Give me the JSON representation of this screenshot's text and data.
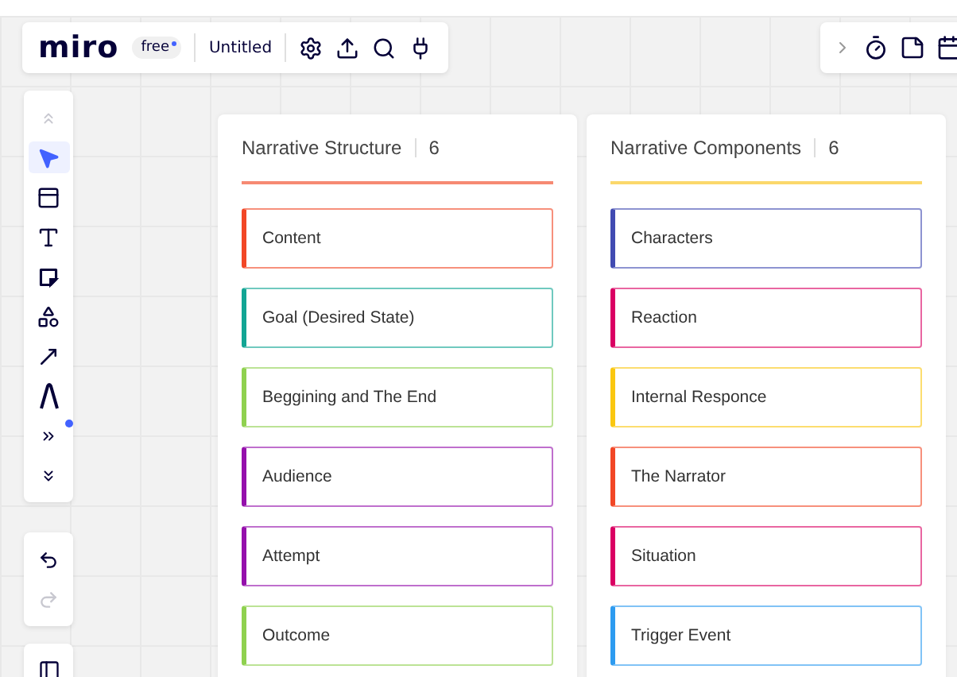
{
  "topbar": {
    "logo": "miro",
    "plan": "free",
    "plan_dot": true,
    "board_title": "Untitled",
    "actions": [
      {
        "kind": "settings"
      },
      {
        "kind": "upload"
      },
      {
        "kind": "search"
      },
      {
        "kind": "plug"
      }
    ]
  },
  "right_toolbar": {
    "items": [
      {
        "kind": "expand"
      },
      {
        "kind": "timer"
      },
      {
        "kind": "sticky"
      },
      {
        "kind": "partial"
      }
    ]
  },
  "tools": [
    {
      "kind": "collapse",
      "selected": false,
      "disabled": true
    },
    {
      "kind": "select",
      "selected": true,
      "disabled": false
    },
    {
      "kind": "frame",
      "selected": false,
      "disabled": false
    },
    {
      "kind": "text",
      "selected": false,
      "disabled": false
    },
    {
      "kind": "sticky",
      "selected": false,
      "disabled": false
    },
    {
      "kind": "shapes",
      "selected": false,
      "disabled": false
    },
    {
      "kind": "arrow",
      "selected": false,
      "disabled": false
    },
    {
      "kind": "pen",
      "selected": false,
      "disabled": false
    },
    {
      "kind": "more",
      "selected": false,
      "disabled": false
    },
    {
      "kind": "expand",
      "selected": false,
      "disabled": false
    }
  ],
  "more_tools_badge": true,
  "history": [
    {
      "kind": "undo",
      "disabled": false
    },
    {
      "kind": "redo",
      "disabled": true
    }
  ],
  "columns": [
    {
      "title": "Narrative Structure",
      "count": "6",
      "color": "#f68a73",
      "cards": [
        {
          "text": "Content",
          "color": "#f24726"
        },
        {
          "text": "Goal (Desired State)",
          "color": "#12a594"
        },
        {
          "text": "Beggining and The End",
          "color": "#8fd14f"
        },
        {
          "text": "Audience",
          "color": "#9510ac"
        },
        {
          "text": "Attempt",
          "color": "#9510ac"
        },
        {
          "text": "Outcome",
          "color": "#8fd14f"
        }
      ]
    },
    {
      "title": "Narrative Components",
      "count": "6",
      "color": "#fbd86b",
      "cards": [
        {
          "text": "Characters",
          "color": "#414bb2"
        },
        {
          "text": "Reaction",
          "color": "#da0063"
        },
        {
          "text": "Internal Responce",
          "color": "#fac710"
        },
        {
          "text": "The Narrator",
          "color": "#f24726"
        },
        {
          "text": "Situation",
          "color": "#da0063"
        },
        {
          "text": "Trigger Event",
          "color": "#2d9bf0"
        }
      ]
    }
  ]
}
